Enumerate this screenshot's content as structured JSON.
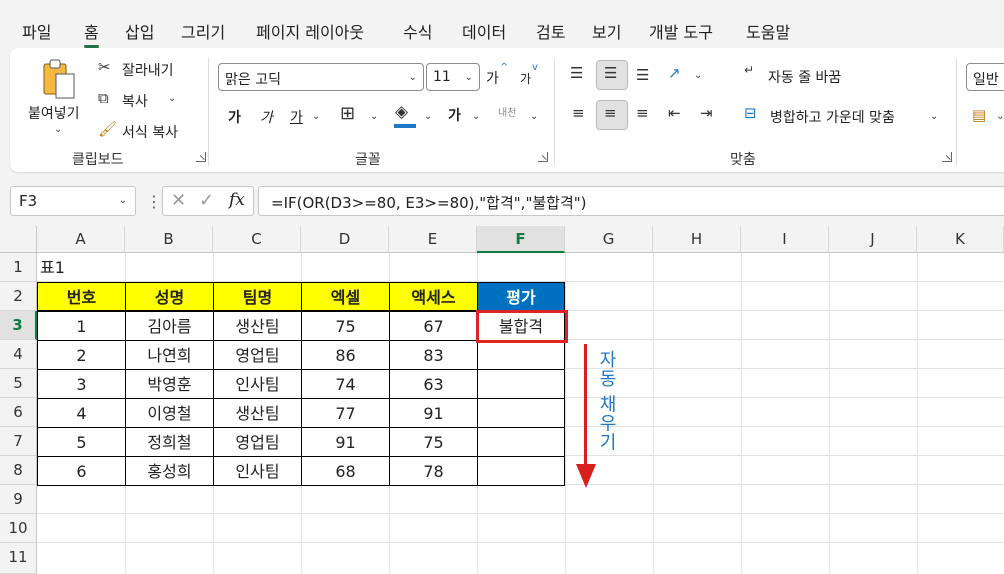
{
  "menu": {
    "tabs": [
      "파일",
      "홈",
      "삽입",
      "그리기",
      "페이지 레이아웃",
      "수식",
      "데이터",
      "검토",
      "보기",
      "개발 도구",
      "도움말"
    ],
    "active": "홈"
  },
  "ribbon": {
    "clipboard": {
      "paste": "붙여넣기",
      "cut": "잘라내기",
      "copy": "복사",
      "format_painter": "서식 복사",
      "label": "클립보드"
    },
    "font": {
      "name": "맑은 고딕",
      "size": "11",
      "grow": "가",
      "shrink": "가",
      "bold": "가",
      "italic": "가",
      "underline": "가",
      "font_color": "가",
      "hangul": "내천",
      "label": "글꼴"
    },
    "alignment": {
      "wrap_text": "자동 줄 바꿈",
      "merge_center": "병합하고 가운데 맞춤",
      "label": "맞춤"
    },
    "number": {
      "format": "일반"
    }
  },
  "formula_bar": {
    "name_box": "F3",
    "fx": "fx",
    "formula": "=IF(OR(D3>=80, E3>=80),\"합격\",\"불합격\")"
  },
  "sheet": {
    "columns": [
      "A",
      "B",
      "C",
      "D",
      "E",
      "F",
      "G",
      "H",
      "I",
      "J",
      "K"
    ],
    "rows": [
      "1",
      "2",
      "3",
      "4",
      "5",
      "6",
      "7",
      "8",
      "9",
      "10",
      "11"
    ],
    "selected_column": "F",
    "selected_row": "3",
    "table_title": "표1",
    "headers": [
      "번호",
      "성명",
      "팀명",
      "엑셀",
      "액세스",
      "평가"
    ],
    "data": [
      [
        "1",
        "김아름",
        "생산팀",
        "75",
        "67",
        "불합격"
      ],
      [
        "2",
        "나연희",
        "영업팀",
        "86",
        "83",
        ""
      ],
      [
        "3",
        "박영훈",
        "인사팀",
        "74",
        "63",
        ""
      ],
      [
        "4",
        "이영철",
        "생산팀",
        "77",
        "91",
        ""
      ],
      [
        "5",
        "정희철",
        "영업팀",
        "91",
        "75",
        ""
      ],
      [
        "6",
        "홍성희",
        "인사팀",
        "68",
        "78",
        ""
      ]
    ],
    "annotation": "자동 채우기"
  },
  "colors": {
    "header_fill": "#ffff00",
    "eval_fill": "#0070c0",
    "highlight": "#e02424",
    "accent": "#107c41"
  }
}
